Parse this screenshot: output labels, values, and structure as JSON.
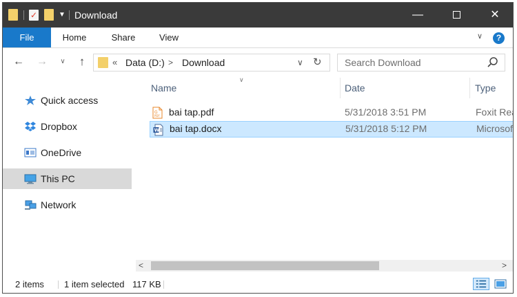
{
  "window": {
    "title": "Download",
    "controls": {
      "minimize": "—",
      "close": "✕"
    }
  },
  "ribbon": {
    "tabs": [
      "File",
      "Home",
      "Share",
      "View"
    ],
    "help": "?"
  },
  "nav": {
    "address": {
      "chevron": "«",
      "crumbs": [
        "Data (D:)",
        "Download"
      ],
      "separator": ">"
    },
    "search_placeholder": "Search Download"
  },
  "sidebar": {
    "items": [
      {
        "label": "Quick access",
        "icon": "star-icon"
      },
      {
        "label": "Dropbox",
        "icon": "dropbox-icon"
      },
      {
        "label": "OneDrive",
        "icon": "onedrive-icon"
      },
      {
        "label": "This PC",
        "icon": "computer-icon",
        "selected": true
      },
      {
        "label": "Network",
        "icon": "network-icon"
      }
    ]
  },
  "file_list": {
    "columns": [
      "Name",
      "Date",
      "Type"
    ],
    "rows": [
      {
        "name": "bai tap.pdf",
        "date": "5/31/2018 3:51 PM",
        "type": "Foxit Rea",
        "icon": "pdf-file-icon",
        "selected": false
      },
      {
        "name": "bai tap.docx",
        "date": "5/31/2018 5:12 PM",
        "type": "Microsof",
        "icon": "word-file-icon",
        "selected": true
      }
    ]
  },
  "status": {
    "item_count": "2 items",
    "selection": "1 item selected",
    "size": "117 KB"
  },
  "colors": {
    "titlebar": "#3a3a3a",
    "accent": "#1979ca",
    "selection": "#cce8ff",
    "folder": "#f3d06a"
  }
}
